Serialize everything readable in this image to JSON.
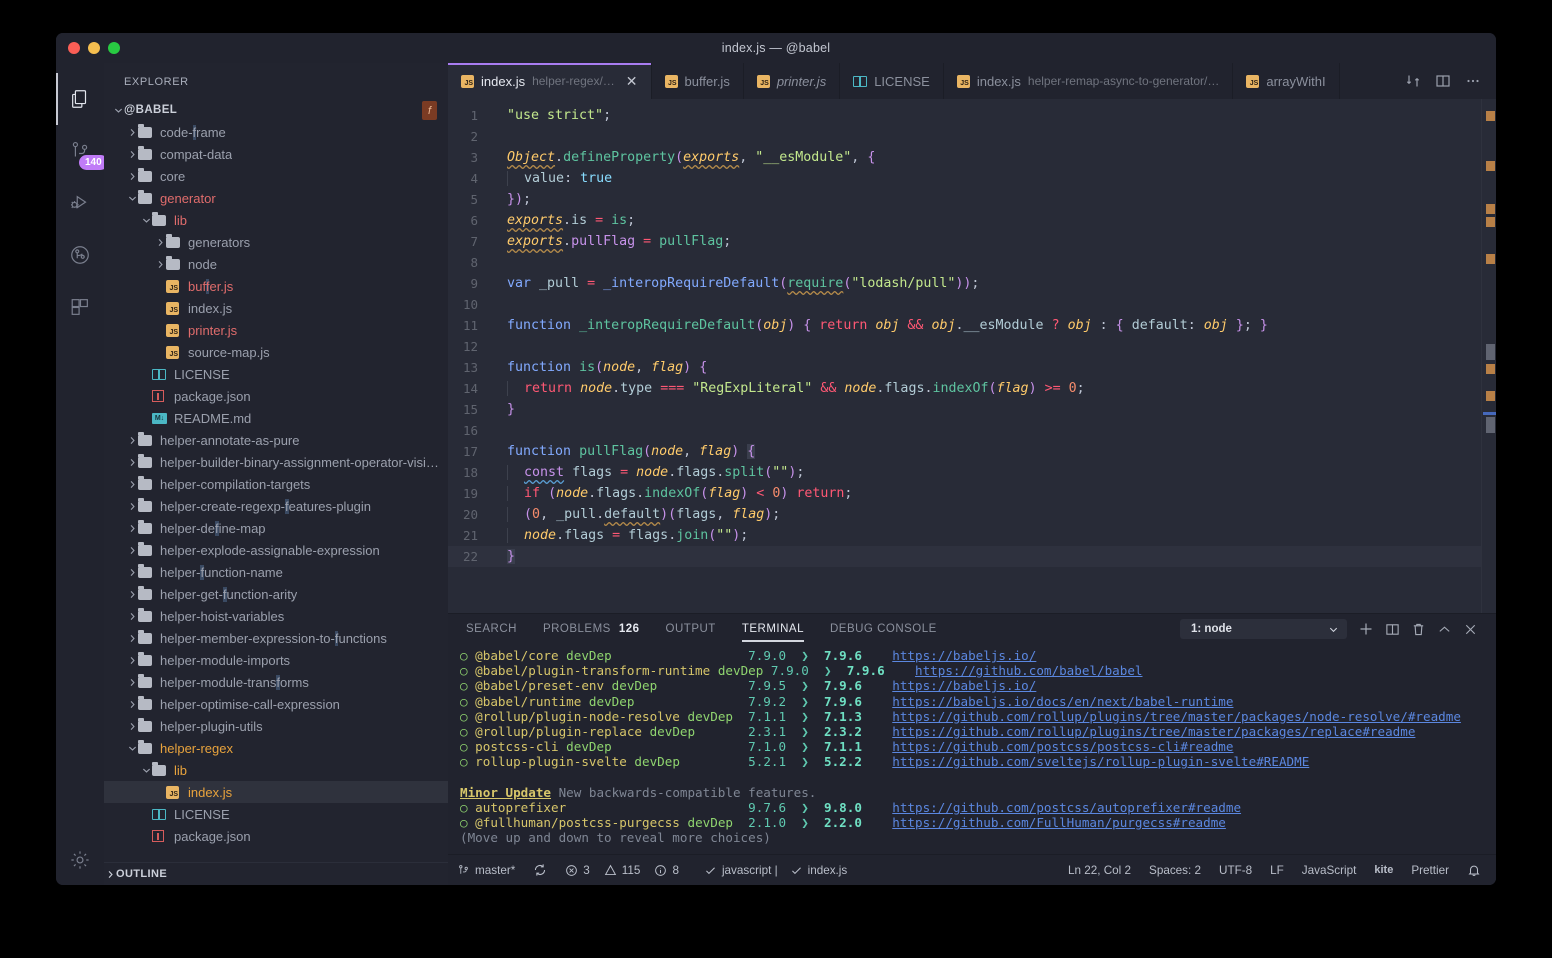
{
  "window": {
    "title": "index.js — @babel"
  },
  "activity_bar": {
    "items": [
      {
        "name": "explorer",
        "icon": "files-icon",
        "active": true
      },
      {
        "name": "source-control",
        "icon": "source-control-icon",
        "badge": "140",
        "active": false
      },
      {
        "name": "run-debug",
        "icon": "run-debug-icon",
        "active": false
      },
      {
        "name": "gitlens",
        "icon": "git-graph-icon",
        "active": false
      },
      {
        "name": "extensions",
        "icon": "extensions-icon",
        "active": false
      }
    ],
    "manage": {
      "icon": "gear-icon"
    }
  },
  "sidebar": {
    "header": "EXPLORER",
    "root": "@BABEL",
    "outline": "OUTLINE",
    "badge": "f",
    "tree": [
      {
        "label": "code-frame",
        "kind": "folder",
        "depth": 1,
        "state": "collapsed",
        "hl": "f"
      },
      {
        "label": "compat-data",
        "kind": "folder",
        "depth": 1,
        "state": "collapsed"
      },
      {
        "label": "core",
        "kind": "folder",
        "depth": 1,
        "state": "collapsed"
      },
      {
        "label": "generator",
        "kind": "folder",
        "depth": 1,
        "state": "expanded",
        "color": "red"
      },
      {
        "label": "lib",
        "kind": "folder",
        "depth": 2,
        "state": "expanded",
        "color": "red"
      },
      {
        "label": "generators",
        "kind": "folder",
        "depth": 3,
        "state": "collapsed"
      },
      {
        "label": "node",
        "kind": "folder",
        "depth": 3,
        "state": "collapsed"
      },
      {
        "label": "buffer.js",
        "kind": "js",
        "depth": 3,
        "color": "red",
        "hl": "f"
      },
      {
        "label": "index.js",
        "kind": "js",
        "depth": 3
      },
      {
        "label": "printer.js",
        "kind": "js",
        "depth": 3,
        "color": "red"
      },
      {
        "label": "source-map.js",
        "kind": "js",
        "depth": 3
      },
      {
        "label": "LICENSE",
        "kind": "book",
        "depth": 2
      },
      {
        "label": "package.json",
        "kind": "npm",
        "depth": 2
      },
      {
        "label": "README.md",
        "kind": "md",
        "depth": 2
      },
      {
        "label": "helper-annotate-as-pure",
        "kind": "folder",
        "depth": 1,
        "state": "collapsed"
      },
      {
        "label": "helper-builder-binary-assignment-operator-visi…",
        "kind": "folder",
        "depth": 1,
        "state": "collapsed"
      },
      {
        "label": "helper-compilation-targets",
        "kind": "folder",
        "depth": 1,
        "state": "collapsed"
      },
      {
        "label": "helper-create-regexp-features-plugin",
        "kind": "folder",
        "depth": 1,
        "state": "collapsed",
        "hl": "f"
      },
      {
        "label": "helper-define-map",
        "kind": "folder",
        "depth": 1,
        "state": "collapsed",
        "hl": "f"
      },
      {
        "label": "helper-explode-assignable-expression",
        "kind": "folder",
        "depth": 1,
        "state": "collapsed"
      },
      {
        "label": "helper-function-name",
        "kind": "folder",
        "depth": 1,
        "state": "collapsed",
        "hl": "f"
      },
      {
        "label": "helper-get-function-arity",
        "kind": "folder",
        "depth": 1,
        "state": "collapsed",
        "hl": "f"
      },
      {
        "label": "helper-hoist-variables",
        "kind": "folder",
        "depth": 1,
        "state": "collapsed"
      },
      {
        "label": "helper-member-expression-to-functions",
        "kind": "folder",
        "depth": 1,
        "state": "collapsed",
        "hl": "f"
      },
      {
        "label": "helper-module-imports",
        "kind": "folder",
        "depth": 1,
        "state": "collapsed"
      },
      {
        "label": "helper-module-transforms",
        "kind": "folder",
        "depth": 1,
        "state": "collapsed",
        "hl": "f"
      },
      {
        "label": "helper-optimise-call-expression",
        "kind": "folder",
        "depth": 1,
        "state": "collapsed"
      },
      {
        "label": "helper-plugin-utils",
        "kind": "folder",
        "depth": 1,
        "state": "collapsed"
      },
      {
        "label": "helper-regex",
        "kind": "folder",
        "depth": 1,
        "state": "expanded",
        "color": "orange"
      },
      {
        "label": "lib",
        "kind": "folder",
        "depth": 2,
        "state": "expanded",
        "color": "orange"
      },
      {
        "label": "index.js",
        "kind": "js",
        "depth": 3,
        "color": "orange",
        "selected": true
      },
      {
        "label": "LICENSE",
        "kind": "book",
        "depth": 2
      },
      {
        "label": "package.json",
        "kind": "npm",
        "depth": 2
      }
    ]
  },
  "tabs": [
    {
      "label": "index.js",
      "sub": "helper-regex/…",
      "icon": "js-icon",
      "active": true,
      "dirty": false,
      "close": "✕"
    },
    {
      "label": "buffer.js",
      "sub": "",
      "icon": "js-icon",
      "active": false
    },
    {
      "label": "printer.js",
      "sub": "",
      "icon": "js-icon",
      "active": false,
      "italic": true
    },
    {
      "label": "LICENSE",
      "sub": "",
      "icon": "license-icon",
      "active": false
    },
    {
      "label": "index.js",
      "sub": "helper-remap-async-to-generator/…",
      "icon": "js-icon",
      "active": false
    },
    {
      "label": "arrayWithI",
      "sub": "",
      "icon": "js-icon",
      "active": false
    }
  ],
  "tab_actions": [
    {
      "name": "split-sync-icon"
    },
    {
      "name": "split-editor-icon"
    },
    {
      "name": "more-actions-icon"
    }
  ],
  "editor": {
    "lines": [
      {
        "n": "1"
      },
      {
        "n": "2"
      },
      {
        "n": "3"
      },
      {
        "n": "4"
      },
      {
        "n": "5"
      },
      {
        "n": "6"
      },
      {
        "n": "7"
      },
      {
        "n": "8"
      },
      {
        "n": "9"
      },
      {
        "n": "10"
      },
      {
        "n": "11"
      },
      {
        "n": "12"
      },
      {
        "n": "13"
      },
      {
        "n": "14"
      },
      {
        "n": "15"
      },
      {
        "n": "16"
      },
      {
        "n": "17"
      },
      {
        "n": "18"
      },
      {
        "n": "19"
      },
      {
        "n": "20"
      },
      {
        "n": "21"
      },
      {
        "n": "22"
      }
    ],
    "source": [
      "\"use strict\";",
      "",
      "Object.defineProperty(exports, \"__esModule\", {",
      "  value: true",
      "});",
      "exports.is = is;",
      "exports.pullFlag = pullFlag;",
      "",
      "var _pull = _interopRequireDefault(require(\"lodash/pull\"));",
      "",
      "function _interopRequireDefault(obj) { return obj && obj.__esModule ? obj : { default: obj }; }",
      "",
      "function is(node, flag) {",
      "  return node.type === \"RegExpLiteral\" && node.flags.indexOf(flag) >= 0;",
      "}",
      "",
      "function pullFlag(node, flag) {",
      "  const flags = node.flags.split(\"\");",
      "  if (node.flags.indexOf(flag) < 0) return;",
      "  (0, _pull.default)(flags, flag);",
      "  node.flags = flags.join(\"\");",
      "}"
    ],
    "cursor_line": 22
  },
  "panel": {
    "tabs": [
      {
        "label": "SEARCH",
        "active": false
      },
      {
        "label": "PROBLEMS",
        "active": false,
        "count": "126"
      },
      {
        "label": "OUTPUT",
        "active": false
      },
      {
        "label": "TERMINAL",
        "active": true
      },
      {
        "label": "DEBUG CONSOLE",
        "active": false
      }
    ],
    "terminal_select": "1: node",
    "actions": [
      {
        "name": "new-terminal-icon",
        "glyph": "+"
      },
      {
        "name": "split-terminal-icon"
      },
      {
        "name": "kill-terminal-icon"
      },
      {
        "name": "maximize-panel-icon",
        "glyph": "^"
      },
      {
        "name": "close-panel-icon",
        "glyph": "✕"
      }
    ],
    "terminal": {
      "rows": [
        {
          "pkg": "@babel/core",
          "dep": "devDep",
          "from": "7.9.0",
          "to": "7.9.6",
          "url": "https://babeljs.io/"
        },
        {
          "pkg": "@babel/plugin-transform-runtime",
          "dep": "devDep",
          "from": "7.9.0",
          "to": "7.9.6",
          "url": "https://github.com/babel/babel"
        },
        {
          "pkg": "@babel/preset-env",
          "dep": "devDep",
          "from": "7.9.5",
          "to": "7.9.6",
          "url": "https://babeljs.io/"
        },
        {
          "pkg": "@babel/runtime",
          "dep": "devDep",
          "from": "7.9.2",
          "to": "7.9.6",
          "url": "https://babeljs.io/docs/en/next/babel-runtime"
        },
        {
          "pkg": "@rollup/plugin-node-resolve",
          "dep": "devDep",
          "from": "7.1.1",
          "to": "7.1.3",
          "url": "https://github.com/rollup/plugins/tree/master/packages/node-resolve/#readme"
        },
        {
          "pkg": "@rollup/plugin-replace",
          "dep": "devDep",
          "from": "2.3.1",
          "to": "2.3.2",
          "url": "https://github.com/rollup/plugins/tree/master/packages/replace#readme"
        },
        {
          "pkg": "postcss-cli",
          "dep": "devDep",
          "from": "7.1.0",
          "to": "7.1.1",
          "url": "https://github.com/postcss/postcss-cli#readme"
        },
        {
          "pkg": "rollup-plugin-svelte",
          "dep": "devDep",
          "from": "5.2.1",
          "to": "5.2.2",
          "url": "https://github.com/sveltejs/rollup-plugin-svelte#README"
        }
      ],
      "section_title": "Minor Update",
      "section_desc": "New backwards-compatible features.",
      "rows2": [
        {
          "pkg": "autoprefixer",
          "dep": "",
          "from": "9.7.6",
          "to": "9.8.0",
          "url": "https://github.com/postcss/autoprefixer#readme"
        },
        {
          "pkg": "@fullhuman/postcss-purgecss",
          "dep": "devDep",
          "from": "2.1.0",
          "to": "2.2.0",
          "url": "https://github.com/FullHuman/purgecss#readme"
        }
      ],
      "footer": "(Move up and down to reveal more choices)",
      "arrow": "❯",
      "bullet": "○"
    }
  },
  "status_bar": {
    "left": [
      {
        "name": "branch",
        "icon": "source-control-icon",
        "label": "master*"
      },
      {
        "name": "sync",
        "icon": "sync-icon",
        "label": ""
      },
      {
        "name": "errors",
        "icon": "error-icon",
        "label": "3"
      },
      {
        "name": "warnings",
        "icon": "warning-icon",
        "label": "115"
      },
      {
        "name": "infos",
        "icon": "info-icon",
        "label": "8"
      },
      {
        "name": "eslint-javascript",
        "icon": "check-icon",
        "label": "javascript |"
      },
      {
        "name": "eslint-file",
        "icon": "check-icon",
        "label": "index.js"
      }
    ],
    "right": [
      {
        "name": "cursor-position",
        "label": "Ln 22, Col 2"
      },
      {
        "name": "indentation",
        "label": "Spaces: 2"
      },
      {
        "name": "encoding",
        "label": "UTF-8"
      },
      {
        "name": "eol",
        "label": "LF"
      },
      {
        "name": "language-mode",
        "label": "JavaScript"
      },
      {
        "name": "kite",
        "label": "kite"
      },
      {
        "name": "prettier",
        "label": "Prettier"
      },
      {
        "name": "notifications",
        "label": "",
        "icon": "bell-icon"
      }
    ]
  },
  "colors": {
    "accent": "#a87cf0",
    "badge": "#c07bf7",
    "editor_bg": "#282b37",
    "chrome_bg": "#21232e"
  }
}
